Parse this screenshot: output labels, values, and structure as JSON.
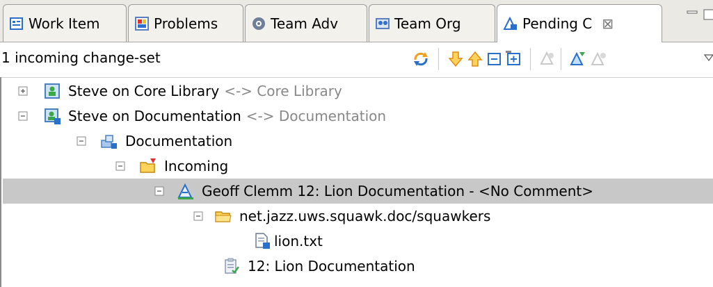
{
  "tabs": [
    {
      "label": "Work Item",
      "icon": "work-item-icon"
    },
    {
      "label": "Problems",
      "icon": "problems-icon"
    },
    {
      "label": "Team Adv",
      "icon": "team-advisor-icon"
    },
    {
      "label": "Team Org",
      "icon": "team-org-icon"
    },
    {
      "label": "Pending C",
      "icon": "pending-changes-icon",
      "active": true,
      "close": "⊠"
    }
  ],
  "toolbar": {
    "summary": "1 incoming change-set"
  },
  "tree": [
    {
      "label": "Steve on Core Library",
      "suffix": "<-> Core Library",
      "icon": "repository-workspace-icon",
      "expanded": false
    },
    {
      "label": "Steve on Documentation",
      "suffix": "<-> Documentation",
      "icon": "repository-workspace-incoming-icon",
      "expanded": true
    },
    {
      "label": "Documentation",
      "icon": "component-icon",
      "expanded": true
    },
    {
      "label": "Incoming",
      "icon": "incoming-folder-icon",
      "expanded": true
    },
    {
      "label": "Geoff Clemm  12: Lion Documentation - <No Comment>",
      "icon": "change-set-icon",
      "expanded": true,
      "selected": true
    },
    {
      "label": "net.jazz.uws.squawk.doc/squawkers",
      "icon": "folder-icon",
      "expanded": true
    },
    {
      "label": "lion.txt",
      "icon": "incoming-file-icon"
    },
    {
      "label": "12: Lion Documentation",
      "icon": "work-item-link-icon"
    }
  ],
  "colors": {
    "selection": "#c8c8c8",
    "accent_blue": "#2a6fc9",
    "arrow_orange": "#f0a020"
  }
}
